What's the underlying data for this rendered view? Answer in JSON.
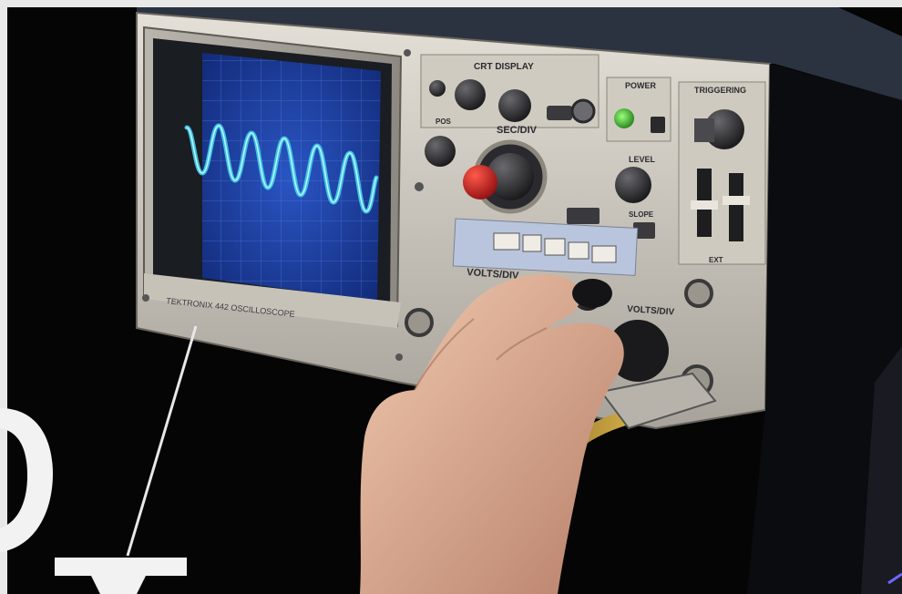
{
  "photo": {
    "panel_labels": {
      "crt_display": "CRT DISPLAY",
      "power": "POWER",
      "triggering": "TRIGGERING",
      "sec_div": "SEC/DIV",
      "level": "LEVEL",
      "slope": "SLOPE",
      "volts_div": "VOLTS/DIV",
      "volts_div_2": "VOLTS/DIV",
      "ext": "EXT",
      "brand": "TEKTRONIX 442 OSCILLOSCOPE",
      "pos": "POS"
    },
    "colors": {
      "screen": "#1c3fa6",
      "trace": "#3ec9e8",
      "panel": "#d9d4c9",
      "knob_red": "#c0141a",
      "power_led": "#3fbf3a",
      "background": "#050505"
    },
    "waveform": {
      "cycles": 6,
      "type": "sine"
    }
  }
}
